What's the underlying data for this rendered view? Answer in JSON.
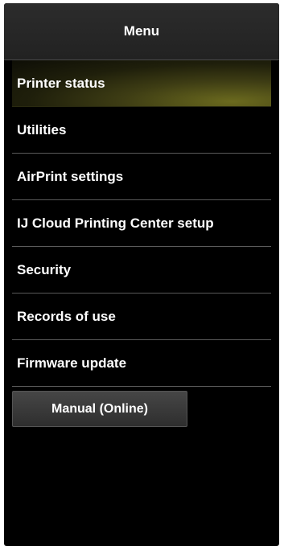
{
  "header": {
    "title": "Menu"
  },
  "menu": {
    "items": [
      {
        "label": "Printer status"
      },
      {
        "label": "Utilities"
      },
      {
        "label": "AirPrint settings"
      },
      {
        "label": "IJ Cloud Printing Center setup"
      },
      {
        "label": "Security"
      },
      {
        "label": "Records of use"
      },
      {
        "label": "Firmware update"
      }
    ],
    "active_item": "Printer status"
  },
  "manual_button": {
    "label": "Manual (Online)"
  },
  "colors": {
    "background": "#000000",
    "header": "#262626",
    "active_highlight": "#6b6a1e",
    "text": "#ffffff",
    "divider": "#5a5a5a"
  }
}
